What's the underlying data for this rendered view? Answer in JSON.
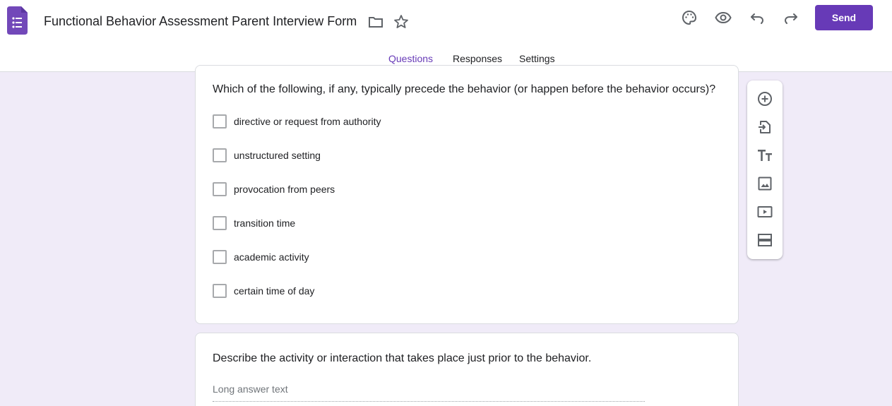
{
  "header": {
    "title": "Functional Behavior Assessment Parent Interview Form",
    "send_label": "Send",
    "icons": [
      "forms-logo",
      "folder-icon",
      "star-icon",
      "palette-icon",
      "eye-icon",
      "undo-icon",
      "redo-icon"
    ]
  },
  "tabs": [
    {
      "label": "Questions",
      "active": true
    },
    {
      "label": "Responses",
      "active": false
    },
    {
      "label": "Settings",
      "active": false
    }
  ],
  "question1": {
    "title": "Which of the following, if any, typically precede the behavior (or happen before the behavior occurs)?",
    "options": [
      "directive or request from authority",
      "unstructured setting",
      "provocation from peers",
      "transition time",
      "academic activity",
      "certain time of day"
    ]
  },
  "question2": {
    "title": "Describe the activity or interaction that takes place just prior to the behavior.",
    "placeholder": "Long answer text"
  },
  "toolbar": {
    "icons": [
      "add-question-icon",
      "import-questions-icon",
      "add-title-icon",
      "add-image-icon",
      "add-video-icon",
      "add-section-icon"
    ]
  },
  "colors": {
    "accent": "#673ab7",
    "background": "#f0ebf8"
  }
}
